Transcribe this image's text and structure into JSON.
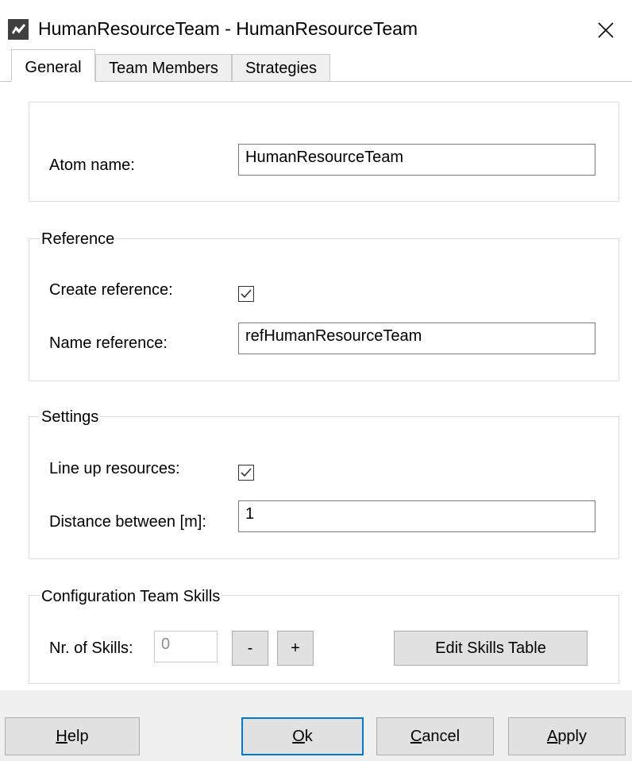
{
  "window": {
    "title": "HumanResourceTeam - HumanResourceTeam"
  },
  "tabs": [
    {
      "label": "General",
      "active": true
    },
    {
      "label": "Team Members",
      "active": false
    },
    {
      "label": "Strategies",
      "active": false
    }
  ],
  "atom": {
    "label": "Atom name:",
    "value": "HumanResourceTeam"
  },
  "reference": {
    "legend": "Reference",
    "create_label": "Create reference:",
    "create_checked": true,
    "name_label": "Name reference:",
    "name_value": "refHumanResourceTeam"
  },
  "settings": {
    "legend": "Settings",
    "lineup_label": "Line up resources:",
    "lineup_checked": true,
    "distance_label": "Distance between [m]:",
    "distance_value": "1"
  },
  "skills": {
    "legend": "Configuration Team Skills",
    "nr_label": "Nr. of Skills:",
    "nr_value": "0",
    "minus_label": "-",
    "plus_label": "+",
    "edit_label": "Edit Skills Table"
  },
  "footer": {
    "help": {
      "first": "H",
      "rest": "elp"
    },
    "ok": {
      "first": "O",
      "rest": "k"
    },
    "cancel": {
      "first": "C",
      "rest": "ancel"
    },
    "apply": {
      "first": "A",
      "rest": "pply"
    }
  },
  "icons": {
    "app": "app-icon",
    "close": "close-icon",
    "check": "checkmark-icon"
  },
  "colors": {
    "accent": "#0078d7",
    "button_bg": "#e1e1e1",
    "border": "#dcdcdc"
  }
}
